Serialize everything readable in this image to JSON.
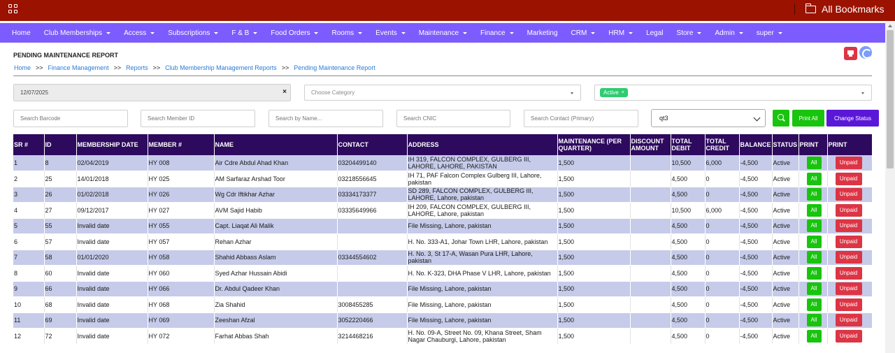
{
  "app": {
    "bookmarks_label": "All Bookmarks"
  },
  "nav": [
    {
      "label": "Home",
      "dropdown": false
    },
    {
      "label": "Club Memberships",
      "dropdown": true
    },
    {
      "label": "Access",
      "dropdown": true
    },
    {
      "label": "Subscriptions",
      "dropdown": true
    },
    {
      "label": "F & B",
      "dropdown": true
    },
    {
      "label": "Food Orders",
      "dropdown": true
    },
    {
      "label": "Rooms",
      "dropdown": true
    },
    {
      "label": "Events",
      "dropdown": true
    },
    {
      "label": "Maintenance",
      "dropdown": true
    },
    {
      "label": "Finance",
      "dropdown": true
    },
    {
      "label": "Marketing",
      "dropdown": false
    },
    {
      "label": "CRM",
      "dropdown": true
    },
    {
      "label": "HRM",
      "dropdown": true
    },
    {
      "label": "Legal",
      "dropdown": false
    },
    {
      "label": "Store",
      "dropdown": true
    },
    {
      "label": "Admin",
      "dropdown": true
    },
    {
      "label": "super",
      "dropdown": true
    }
  ],
  "page": {
    "title": "PENDING MAINTENANCE REPORT",
    "breadcrumb": [
      "Home",
      "Finance Management",
      "Reports",
      "Club Membership Management Reports",
      "Pending Maintenance Report"
    ],
    "breadcrumb_sep": ">>"
  },
  "filters": {
    "date_value": "12/07/2025",
    "category_placeholder": "Choose Category",
    "status_tag": "Active",
    "barcode_placeholder": "Search Barcode",
    "member_id_placeholder": "Search Member ID",
    "name_placeholder": "Search by Name...",
    "cnic_placeholder": "Search CNIC",
    "contact_placeholder": "Search Contact (Primary)",
    "quarter_selected": "qt3",
    "print_all_label": "Print All",
    "change_status_label": "Change Status"
  },
  "table": {
    "headers": [
      "SR #",
      "ID",
      "MEMBERSHIP DATE",
      "MEMBER #",
      "NAME",
      "CONTACT",
      "ADDRESS",
      "MAINTENANCE (PER QUARTER)",
      "DISCOUNT AMOUNT",
      "TOTAL DEBIT",
      "TOTAL CREDIT",
      "BALANCE",
      "STATUS",
      "PRINT",
      "PRINT"
    ],
    "all_label": "All",
    "unpaid_label": "Unpaid",
    "rows": [
      [
        "1",
        "8",
        "02/04/2019",
        "HY 008",
        "Air Cdre Abdul Ahad Khan",
        "03204499140",
        "IH 319, FALCON COMPLEX, GULBERG III, LAHORE, LAHORE, PAKISTAN",
        "1,500",
        "",
        "10,500",
        "6,000",
        "-4,500",
        "Active"
      ],
      [
        "2",
        "25",
        "14/01/2018",
        "HY 025",
        "AM Sarfaraz Arshad Toor",
        "03218556645",
        "IH 71, PAF Falcon Complex Gulberg III, Lahore, pakistan",
        "1,500",
        "",
        "4,500",
        "0",
        "-4,500",
        "Active"
      ],
      [
        "3",
        "26",
        "01/02/2018",
        "HY 026",
        "Wg Cdr Iftikhar Azhar",
        "03334173377",
        "SD 289, FALCON COMPLEX, GULBERG III, LAHORE, Lahore, pakistan",
        "1,500",
        "",
        "4,500",
        "0",
        "-4,500",
        "Active"
      ],
      [
        "4",
        "27",
        "09/12/2017",
        "HY 027",
        "AVM Sajid Habib",
        "03335649966",
        "IH 209, FALCON COMPLEX, GULBERG III, LAHORE, Lahore, pakistan",
        "1,500",
        "",
        "10,500",
        "6,000",
        "-4,500",
        "Active"
      ],
      [
        "5",
        "55",
        "Invalid date",
        "HY 055",
        "Capt. Liaqat Ali Malik",
        "",
        "File Missing, Lahore, pakistan",
        "1,500",
        "",
        "4,500",
        "0",
        "-4,500",
        "Active"
      ],
      [
        "6",
        "57",
        "Invalid date",
        "HY 057",
        "Rehan Azhar",
        "",
        "H. No. 333-A1, Johar Town LHR, Lahore, pakistan",
        "1,500",
        "",
        "4,500",
        "0",
        "-4,500",
        "Active"
      ],
      [
        "7",
        "58",
        "01/01/2020",
        "HY 058",
        "Shahid Abbass Aslam",
        "03344554602",
        "H. No. 3, St 17-A, Wasan Pura LHR, Lahore, pakistan",
        "1,500",
        "",
        "4,500",
        "0",
        "-4,500",
        "Active"
      ],
      [
        "8",
        "60",
        "Invalid date",
        "HY 060",
        "Syed Azhar Hussain Abidi",
        "",
        "H. No. K-323, DHA Phase V LHR, Lahore, pakistan",
        "1,500",
        "",
        "4,500",
        "0",
        "-4,500",
        "Active"
      ],
      [
        "9",
        "66",
        "Invalid date",
        "HY 066",
        "Dr. Abdul Qadeer Khan",
        "",
        "File Missing, Lahore, pakistan",
        "1,500",
        "",
        "4,500",
        "0",
        "-4,500",
        "Active"
      ],
      [
        "10",
        "68",
        "Invalid date",
        "HY 068",
        "Zia Shahid",
        "3008455285",
        "File Missing, Lahore, pakistan",
        "1,500",
        "",
        "4,500",
        "0",
        "-4,500",
        "Active"
      ],
      [
        "11",
        "69",
        "Invalid date",
        "HY 069",
        "Zeeshan Afzal",
        "3052220466",
        "File Missing, Lahore, pakistan",
        "1,500",
        "",
        "4,500",
        "0",
        "-4,500",
        "Active"
      ],
      [
        "12",
        "72",
        "Invalid date",
        "HY 072",
        "Farhat Abbas Shah",
        "3214468216",
        "H. No. 09-A, Street No. 09, Khana Street, Sham Nagar Chauburgi, Lahore, pakistan",
        "1,500",
        "",
        "4,500",
        "0",
        "-4,500",
        "Active"
      ]
    ]
  },
  "colors": {
    "topbar": "#9b1200",
    "navbar": "#7c5cff",
    "table_header": "#2d0a5e",
    "row_alt": "#c6cbe9",
    "btn_green": "#19c40e",
    "btn_red": "#dc3545",
    "btn_purple": "#5b17d8"
  }
}
